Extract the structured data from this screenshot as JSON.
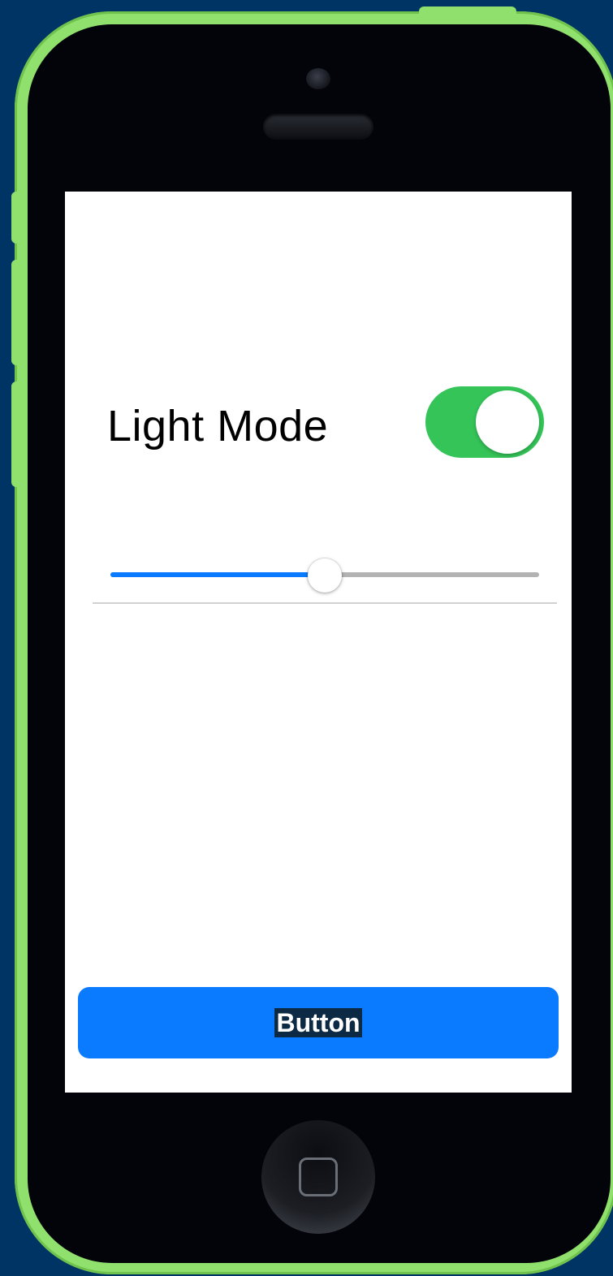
{
  "settings": {
    "mode_label": "Light Mode",
    "mode_toggle": {
      "on": true,
      "color": "#34c458"
    },
    "slider": {
      "value": 0.5,
      "fill_color": "#0a7aff",
      "track_color": "#b3b3b3"
    }
  },
  "action": {
    "button_label": "Button",
    "button_color": "#0a7aff"
  },
  "device": {
    "frame_color": "#8fe06c",
    "background_color": "#003464"
  }
}
